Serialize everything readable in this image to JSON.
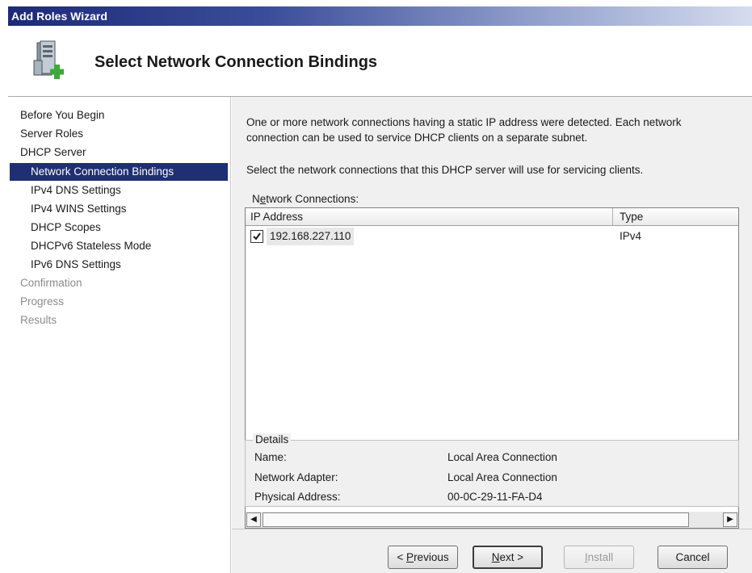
{
  "window": {
    "title": "Add Roles Wizard"
  },
  "header": {
    "title": "Select Network Connection Bindings",
    "icon": "server-add-icon"
  },
  "sidebar": {
    "items": [
      {
        "label": "Before You Begin",
        "state": "normal"
      },
      {
        "label": "Server Roles",
        "state": "normal"
      },
      {
        "label": "DHCP Server",
        "state": "normal"
      },
      {
        "label": "Network Connection Bindings",
        "state": "active"
      },
      {
        "label": "IPv4 DNS Settings",
        "state": "normal"
      },
      {
        "label": "IPv4 WINS Settings",
        "state": "normal"
      },
      {
        "label": "DHCP Scopes",
        "state": "normal"
      },
      {
        "label": "DHCPv6 Stateless Mode",
        "state": "normal"
      },
      {
        "label": "IPv6 DNS Settings",
        "state": "normal"
      },
      {
        "label": "Confirmation",
        "state": "disabled"
      },
      {
        "label": "Progress",
        "state": "disabled"
      },
      {
        "label": "Results",
        "state": "disabled"
      }
    ]
  },
  "main": {
    "description": "One or more network connections having a static IP address were detected. Each network connection can be used to service DHCP clients on a separate subnet.",
    "instruction": "Select the network connections that this DHCP server will use for servicing clients.",
    "connections_label_pre": "N",
    "connections_label_acc": "e",
    "connections_label_post": "twork Connections:",
    "list": {
      "columns": [
        "IP Address",
        "Type"
      ],
      "rows": [
        {
          "checked": true,
          "ip": "192.168.227.110",
          "type": "IPv4"
        }
      ]
    },
    "details": {
      "legend": "Details",
      "fields": [
        {
          "label": "Name:",
          "value": "Local Area Connection"
        },
        {
          "label": "Network Adapter:",
          "value": "Local Area Connection"
        },
        {
          "label": "Physical Address:",
          "value": "00-0C-29-11-FA-D4"
        }
      ]
    }
  },
  "buttons": {
    "previous_pre": "< ",
    "previous_acc": "P",
    "previous_post": "revious",
    "next_acc": "N",
    "next_post": "ext >",
    "install_acc": "I",
    "install_post": "nstall",
    "cancel": "Cancel"
  },
  "colors": {
    "titlebar_start": "#1d2a78",
    "active_nav_bg": "#1f2f73",
    "panel_bg": "#f0f0f0"
  }
}
